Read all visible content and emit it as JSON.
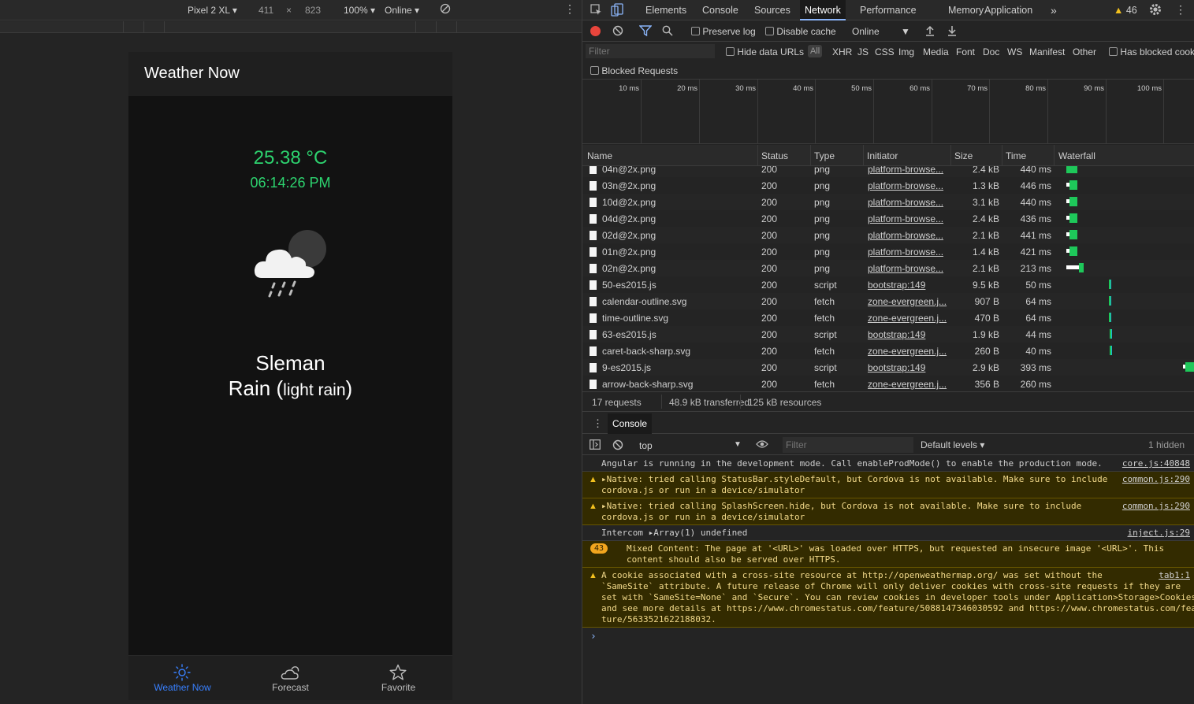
{
  "device_toolbar": {
    "device": "Pixel 2 XL",
    "width": "411",
    "times": "×",
    "height": "823",
    "zoom": "100%",
    "throttle": "Online"
  },
  "app": {
    "title": "Weather Now",
    "temperature": "25.38 °C",
    "time": "06:14:26 PM",
    "city": "Sleman",
    "condition_main": "Rain",
    "condition_desc": "light rain",
    "cond_open": " (",
    "cond_close": ")",
    "tabs": [
      {
        "label": "Weather Now",
        "active": true
      },
      {
        "label": "Forecast",
        "active": false
      },
      {
        "label": "Favorite",
        "active": false
      }
    ],
    "accent": "#2dd36f",
    "tab_active_color": "#3880ff"
  },
  "devtools": {
    "tabs": [
      "Elements",
      "Console",
      "Sources",
      "Network",
      "Performance",
      "Memory",
      "Application"
    ],
    "active_tab": "Network",
    "more": "»",
    "warnings_count": "46",
    "preserve_log": "Preserve log",
    "disable_cache": "Disable cache",
    "throttle": "Online",
    "filter_placeholder": "Filter",
    "hide_data_urls": "Hide data URLs",
    "all": "All",
    "types": [
      "XHR",
      "JS",
      "CSS",
      "Img",
      "Media",
      "Font",
      "Doc",
      "WS",
      "Manifest",
      "Other"
    ],
    "has_blocked": "Has blocked cook",
    "blocked_requests": "Blocked Requests",
    "timeline_labels": [
      "10 ms",
      "20 ms",
      "30 ms",
      "40 ms",
      "50 ms",
      "60 ms",
      "70 ms",
      "80 ms",
      "90 ms",
      "100 ms"
    ],
    "columns": [
      "Name",
      "Status",
      "Type",
      "Initiator",
      "Size",
      "Time",
      "Waterfall"
    ],
    "rows": [
      {
        "name": "04n@2x.png",
        "status": "200",
        "type": "png",
        "initiator": "platform-browse...",
        "size": "2.4 kB",
        "time": "440 ms",
        "wf_start": 8,
        "wf_len": 14,
        "wf_white": 0
      },
      {
        "name": "03n@2x.png",
        "status": "200",
        "type": "png",
        "initiator": "platform-browse...",
        "size": "1.3 kB",
        "time": "446 ms",
        "wf_start": 8,
        "wf_len": 14,
        "wf_white": 4
      },
      {
        "name": "10d@2x.png",
        "status": "200",
        "type": "png",
        "initiator": "platform-browse...",
        "size": "3.1 kB",
        "time": "440 ms",
        "wf_start": 8,
        "wf_len": 14,
        "wf_white": 4
      },
      {
        "name": "04d@2x.png",
        "status": "200",
        "type": "png",
        "initiator": "platform-browse...",
        "size": "2.4 kB",
        "time": "436 ms",
        "wf_start": 8,
        "wf_len": 14,
        "wf_white": 4
      },
      {
        "name": "02d@2x.png",
        "status": "200",
        "type": "png",
        "initiator": "platform-browse...",
        "size": "2.1 kB",
        "time": "441 ms",
        "wf_start": 8,
        "wf_len": 14,
        "wf_white": 4
      },
      {
        "name": "01n@2x.png",
        "status": "200",
        "type": "png",
        "initiator": "platform-browse...",
        "size": "1.4 kB",
        "time": "421 ms",
        "wf_start": 8,
        "wf_len": 14,
        "wf_white": 4
      },
      {
        "name": "02n@2x.png",
        "status": "200",
        "type": "png",
        "initiator": "platform-browse...",
        "size": "2.1 kB",
        "time": "213 ms",
        "wf_start": 8,
        "wf_len": 22,
        "wf_white": 16
      },
      {
        "name": "50-es2015.js",
        "status": "200",
        "type": "script",
        "initiator": "bootstrap:149",
        "size": "9.5 kB",
        "time": "50 ms",
        "wf_start": 62,
        "wf_len": 3,
        "wf_white": 0
      },
      {
        "name": "calendar-outline.svg",
        "status": "200",
        "type": "fetch",
        "initiator": "zone-evergreen.j...",
        "size": "907 B",
        "time": "64 ms",
        "wf_start": 62,
        "wf_len": 3,
        "wf_white": 0
      },
      {
        "name": "time-outline.svg",
        "status": "200",
        "type": "fetch",
        "initiator": "zone-evergreen.j...",
        "size": "470 B",
        "time": "64 ms",
        "wf_start": 62,
        "wf_len": 3,
        "wf_white": 0
      },
      {
        "name": "63-es2015.js",
        "status": "200",
        "type": "script",
        "initiator": "bootstrap:149",
        "size": "1.9 kB",
        "time": "44 ms",
        "wf_start": 63,
        "wf_len": 3,
        "wf_white": 0
      },
      {
        "name": "caret-back-sharp.svg",
        "status": "200",
        "type": "fetch",
        "initiator": "zone-evergreen.j...",
        "size": "260 B",
        "time": "40 ms",
        "wf_start": 63,
        "wf_len": 3,
        "wf_white": 0
      },
      {
        "name": "9-es2015.js",
        "status": "200",
        "type": "script",
        "initiator": "bootstrap:149",
        "size": "2.9 kB",
        "time": "393 ms",
        "wf_start": 156,
        "wf_len": 16,
        "wf_white": 3
      },
      {
        "name": "arrow-back-sharp.svg",
        "status": "200",
        "type": "fetch",
        "initiator": "zone-evergreen.j...",
        "size": "356 B",
        "time": "260 ms",
        "wf_start": 172,
        "wf_len": 4,
        "wf_white": 0
      }
    ],
    "summary": [
      "17 requests",
      "48.9 kB transferred",
      "125 kB resources"
    ],
    "drawer_tab": "Console",
    "console_context": "top",
    "console_filter": "Filter",
    "default_levels": "Default levels",
    "hidden": "1 hidden",
    "messages": [
      {
        "kind": "info",
        "lines": [
          "Angular is running in the development mode. Call enableProdMode() to enable the production mode."
        ],
        "src": "core.js:40848"
      },
      {
        "kind": "warn",
        "lines": [
          "▸Native: tried calling StatusBar.styleDefault, but Cordova is not available. Make sure to include",
          "cordova.js or run in a device/simulator"
        ],
        "src": "common.js:290"
      },
      {
        "kind": "warn",
        "lines": [
          "▸Native: tried calling SplashScreen.hide, but Cordova is not available. Make sure to include",
          "cordova.js or run in a device/simulator"
        ],
        "src": "common.js:290"
      },
      {
        "kind": "info",
        "lines": [
          "Intercom ▸Array(1) undefined"
        ],
        "src": "inject.js:29"
      },
      {
        "kind": "warn",
        "badge": "43",
        "lines": [
          "Mixed Content: The page at '<URL>' was loaded over HTTPS, but requested an insecure image '<URL>'. This",
          "content should also be served over HTTPS."
        ],
        "src": ""
      },
      {
        "kind": "warn",
        "lines": [
          "A cookie associated with a cross-site resource at http://openweathermap.org/ was set without the",
          "`SameSite` attribute. A future release of Chrome will only deliver cookies with cross-site requests if they are",
          "set with `SameSite=None` and `Secure`. You can review cookies in developer tools under Application>Storage>Cookies",
          "and see more details at https://www.chromestatus.com/feature/5088147346030592 and https://www.chromestatus.com/fea",
          "ture/5633521622188032."
        ],
        "src": "tab1:1"
      }
    ],
    "prompt": "›"
  }
}
